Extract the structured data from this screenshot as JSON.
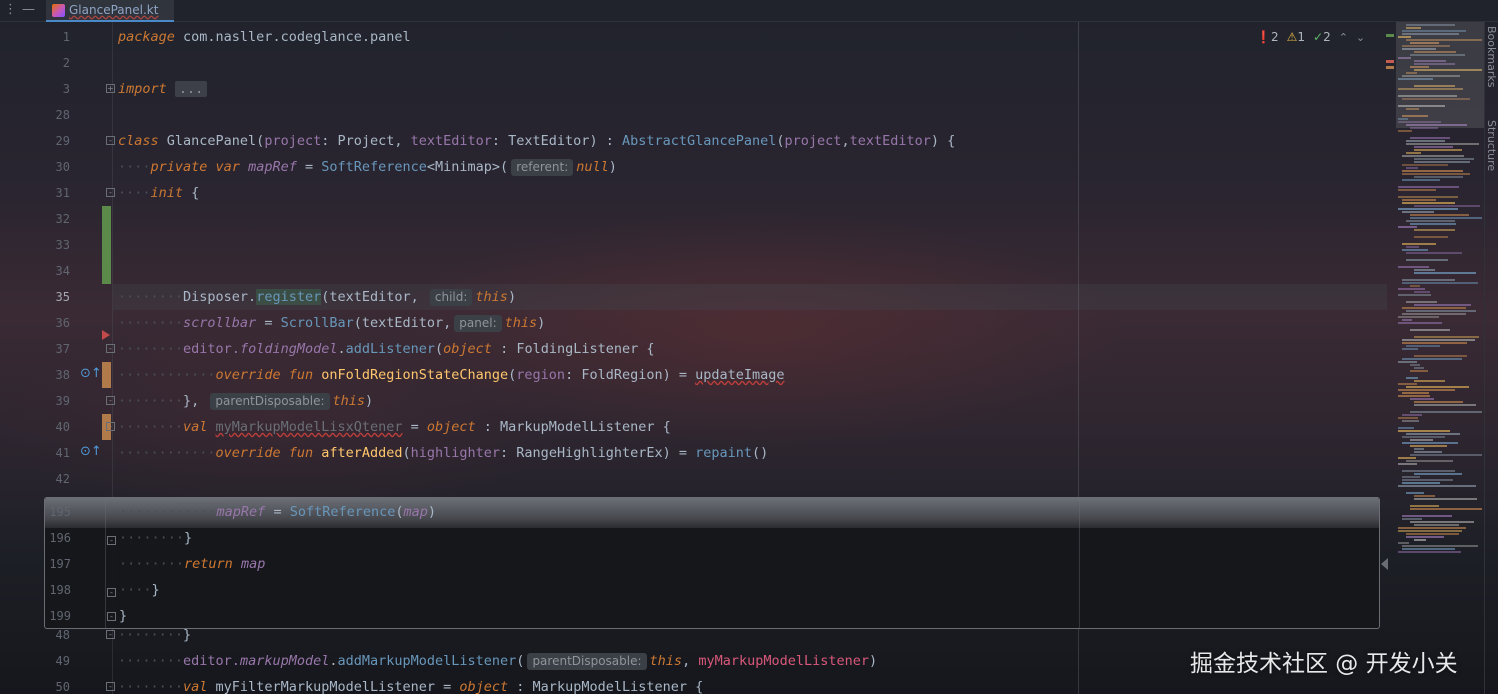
{
  "tab": {
    "filename": "GlancePanel.kt"
  },
  "toolbar_icons": [
    "menu-icon",
    "minimize-icon"
  ],
  "status": {
    "errors": "2",
    "warnings": "1",
    "weak_warnings": "2"
  },
  "colors": {
    "keyword": "#cc7832",
    "property": "#9876aa",
    "function": "#ffc66d",
    "type": "#6897bb",
    "text": "#a9b7c6",
    "accent": "#4a88c7"
  },
  "lines": [
    {
      "n": "1"
    },
    {
      "n": "2"
    },
    {
      "n": "3"
    },
    {
      "n": "28"
    },
    {
      "n": "29"
    },
    {
      "n": "30"
    },
    {
      "n": "31"
    },
    {
      "n": "32"
    },
    {
      "n": "33"
    },
    {
      "n": "34"
    },
    {
      "n": "35"
    },
    {
      "n": "36"
    },
    {
      "n": "37"
    },
    {
      "n": "38"
    },
    {
      "n": "39"
    },
    {
      "n": "40"
    },
    {
      "n": "41"
    },
    {
      "n": "42"
    },
    {
      "n": "48"
    },
    {
      "n": "49"
    },
    {
      "n": "50"
    }
  ],
  "code": {
    "l1_kw": "package",
    "l1_pkg": " com.nasller.codeglance.panel",
    "l3_kw": "import",
    "l3_fold": "...",
    "l29_kw": "class",
    "l29_name": " GlancePanel(",
    "l29_p1": "project",
    "l29_t1": ": Project, ",
    "l29_p2": "textEditor",
    "l29_t2": ": TextEditor) : ",
    "l29_super": "AbstractGlancePanel",
    "l29_args1": "(",
    "l29_a1": "project",
    "l29_comma": ",",
    "l29_a2": "textEditor",
    "l29_end": ") {",
    "l30_kw": "private var ",
    "l30_prop": "mapRef",
    "l30_eq": " = ",
    "l30_fn": "SoftReference",
    "l30_gen": "<Minimap>(",
    "l30_hint": "referent:",
    "l30_null": "null",
    "l30_close": ")",
    "l31_kw": "init",
    "l31_brace": " {",
    "l35_a": "Disposer.",
    "l35_fn": "register",
    "l35_b": "(textEditor, ",
    "l35_hint": "child:",
    "l35_this": "this",
    "l35_c": ")",
    "l36_prop": "scrollbar",
    "l36_eq": " = ",
    "l36_fn": "ScrollBar",
    "l36_b": "(textEditor,",
    "l36_hint": "panel:",
    "l36_this": "this",
    "l36_c": ")",
    "l37_a": "editor.",
    "l37_prop": "foldingModel",
    "l37_b": ".",
    "l37_fn": "addListener",
    "l37_c": "(",
    "l37_kw": "object",
    "l37_d": " : FoldingListener {",
    "l38_kw": "override fun ",
    "l38_fn": "onFoldRegionStateChange",
    "l38_b": "(",
    "l38_p": "region",
    "l38_c": ": FoldRegion) = ",
    "l38_call": "updateImage",
    "l39_a": "}, ",
    "l39_hint": "parentDisposable:",
    "l39_this": "this",
    "l39_c": ")",
    "l40_kw": "val ",
    "l40_name": "myMarkupModelLisxQtener",
    "l40_eq": " = ",
    "l40_obj": "object",
    "l40_d": " : MarkupModelListener {",
    "l41_kw": "override fun ",
    "l41_fn": "afterAdded",
    "l41_b": "(",
    "l41_p": "highlighter",
    "l41_c": ": RangeHighlighterEx) = ",
    "l41_call": "repaint",
    "l41_d": "()",
    "l48": "}",
    "l49_a": "editor.",
    "l49_prop": "markupModel",
    "l49_b": ".",
    "l49_fn": "addMarkupModelListener",
    "l49_c": "(",
    "l49_hint": "parentDisposable:",
    "l49_this": "this",
    "l49_d": ", ",
    "l49_arg": "myMarkupModelListener",
    "l49_e": ")",
    "l50_kw": "val ",
    "l50_name": "myFilterMarkupModelListener",
    "l50_eq": " = ",
    "l50_obj": "object",
    "l50_d": " : MarkupModelListener {"
  },
  "popup": {
    "lines": [
      {
        "n": "195"
      },
      {
        "n": "196"
      },
      {
        "n": "197"
      },
      {
        "n": "198"
      },
      {
        "n": "199"
      }
    ],
    "l195_prop": "mapRef",
    "l195_eq": " = ",
    "l195_fn": "SoftReference",
    "l195_b": "(",
    "l195_arg": "map",
    "l195_c": ")",
    "l196": "}",
    "l197_kw": "return",
    "l197_v": " map",
    "l198": "}",
    "l199": "}"
  },
  "side_tabs": {
    "bookmarks": "Bookmarks",
    "structure": "Structure"
  },
  "watermark": "掘金技术社区 @ 开发小关"
}
